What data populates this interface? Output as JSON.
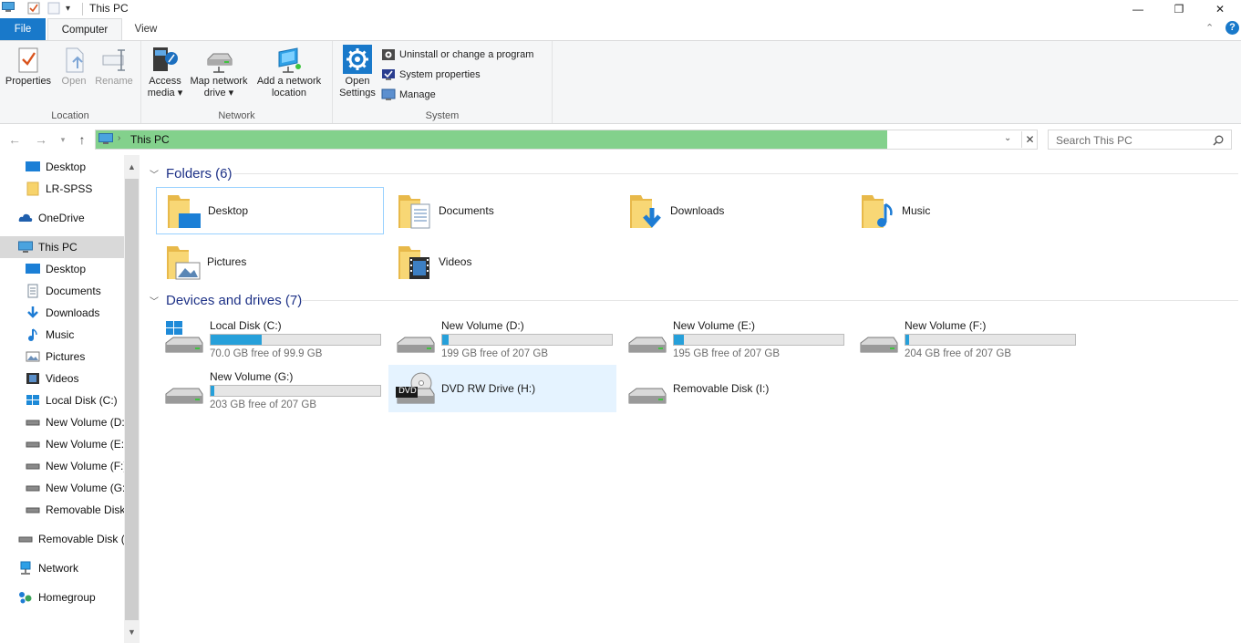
{
  "window": {
    "title": "This PC",
    "icon": "this-pc-icon",
    "minimize": "—",
    "maximize": "❐",
    "close": "✕"
  },
  "ribbon": {
    "tabs": [
      "File",
      "Computer",
      "View"
    ],
    "groups": {
      "location": {
        "label": "Location",
        "buttons": [
          "Properties",
          "Open",
          "Rename"
        ]
      },
      "network": {
        "label": "Network",
        "access_media_l1": "Access",
        "access_media_l2": "media",
        "map_drive_l1": "Map network",
        "map_drive_l2": "drive",
        "add_location_l1": "Add a network",
        "add_location_l2": "location"
      },
      "system": {
        "label": "System",
        "open_settings_l1": "Open",
        "open_settings_l2": "Settings",
        "uninstall": "Uninstall or change a program",
        "system_properties": "System properties",
        "manage": "Manage"
      }
    },
    "help": "?"
  },
  "address": {
    "path": "This PC",
    "search_placeholder": "Search This PC"
  },
  "nav_pane": {
    "items": [
      {
        "label": "Desktop",
        "icon": "desktop-icon"
      },
      {
        "label": "LR-SPSS",
        "icon": "folder-icon"
      },
      {
        "label": "OneDrive",
        "icon": "onedrive-icon"
      },
      {
        "label": "This PC",
        "icon": "this-pc-icon"
      },
      {
        "label": "Desktop",
        "icon": "desktop-icon"
      },
      {
        "label": "Documents",
        "icon": "documents-icon"
      },
      {
        "label": "Downloads",
        "icon": "downloads-icon"
      },
      {
        "label": "Music",
        "icon": "music-icon"
      },
      {
        "label": "Pictures",
        "icon": "pictures-icon"
      },
      {
        "label": "Videos",
        "icon": "videos-icon"
      },
      {
        "label": "Local Disk (C:)",
        "icon": "drive-icon"
      },
      {
        "label": "New Volume (D:)",
        "icon": "drive-icon"
      },
      {
        "label": "New Volume (E:)",
        "icon": "drive-icon"
      },
      {
        "label": "New Volume (F:)",
        "icon": "drive-icon"
      },
      {
        "label": "New Volume (G:)",
        "icon": "drive-icon"
      },
      {
        "label": "Removable Disk",
        "icon": "drive-icon"
      },
      {
        "label": "Removable Disk (I",
        "icon": "drive-icon"
      },
      {
        "label": "Network",
        "icon": "network-icon"
      },
      {
        "label": "Homegroup",
        "icon": "homegroup-icon"
      }
    ]
  },
  "folders": {
    "heading": "Folders (6)",
    "items": [
      "Desktop",
      "Documents",
      "Downloads",
      "Music",
      "Pictures",
      "Videos"
    ]
  },
  "drives": {
    "heading": "Devices and drives (7)",
    "items": [
      {
        "name": "Local Disk (C:)",
        "free": "70.0 GB free of 99.9 GB",
        "used_fraction": 0.3
      },
      {
        "name": "New Volume (D:)",
        "free": "199 GB free of 207 GB",
        "used_fraction": 0.04
      },
      {
        "name": "New Volume (E:)",
        "free": "195 GB free of 207 GB",
        "used_fraction": 0.06
      },
      {
        "name": "New Volume (F:)",
        "free": "204 GB free of 207 GB",
        "used_fraction": 0.015
      },
      {
        "name": "New Volume (G:)",
        "free": "203 GB free of 207 GB",
        "used_fraction": 0.02
      },
      {
        "name": "DVD RW Drive (H:)",
        "free": "",
        "used_fraction": null
      },
      {
        "name": "Removable Disk (I:)",
        "free": "",
        "used_fraction": null
      }
    ],
    "dvd_badge": "DVD"
  }
}
